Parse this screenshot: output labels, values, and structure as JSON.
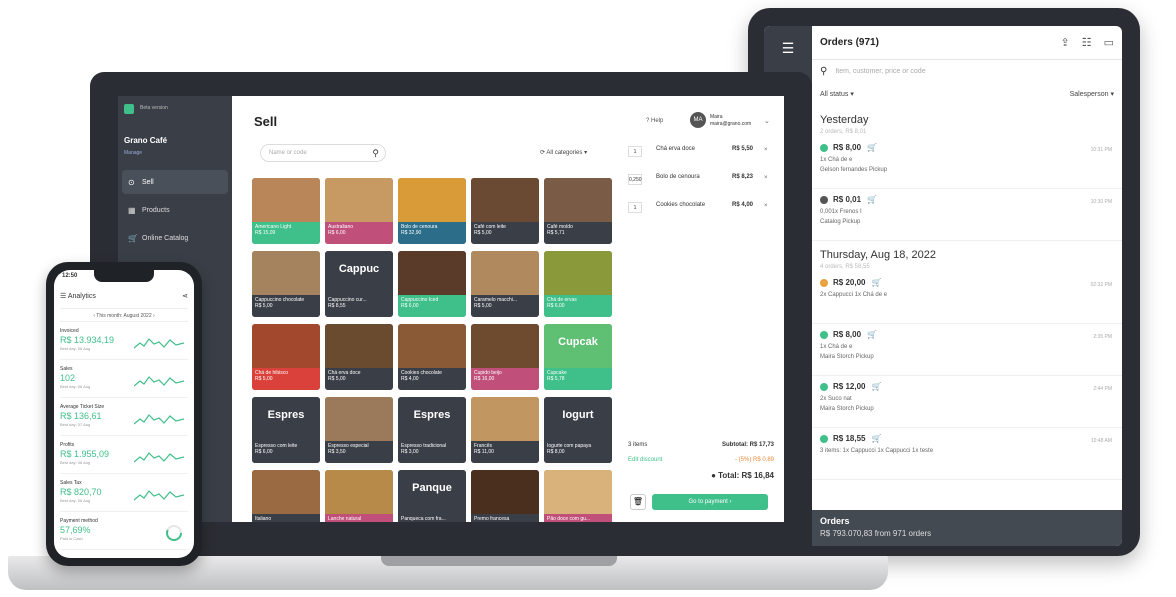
{
  "tablet": {
    "title": "Orders (971)",
    "search_placeholder": "Item, customer, price or code",
    "filter_status": "All status",
    "filter_salesperson": "Salesperson",
    "groups": [
      {
        "title": "Yesterday",
        "sub": "2 orders, R$ 8,01",
        "orders": [
          {
            "amount": "R$ 8,00",
            "line1": "1x Chá de e",
            "line2": "Gelson fernandes  Pickup",
            "time": "10:31 PM",
            "color": "#3fbf8a"
          },
          {
            "amount": "R$ 0,01",
            "line1": "0,001x Frenos I",
            "line2": "Catalog  Pickup",
            "time": "10:30 PM",
            "color": "#555555"
          }
        ]
      },
      {
        "title": "Thursday, Aug 18, 2022",
        "sub": "4 orders, R$ 58,55",
        "orders": [
          {
            "amount": "R$ 20,00",
            "line1": "2x Cappucci 1x Chá de e",
            "line2": "",
            "time": "02:32 PM",
            "color": "#e8a33d"
          },
          {
            "amount": "R$ 8,00",
            "line1": "1x Chá de e",
            "line2": "Maira Storch  Pickup",
            "time": "2:35 PM",
            "color": "#3fbf8a"
          },
          {
            "amount": "R$ 12,00",
            "line1": "2x Suco nat",
            "line2": "Maira Storch  Pickup",
            "time": "2:44 PM",
            "color": "#3fbf8a"
          },
          {
            "amount": "R$ 18,55",
            "line1": "3 items: 1x Cappucci 1x Cappucci 1x teste",
            "line2": "",
            "time": "10:48 AM",
            "color": "#3fbf8a"
          }
        ]
      }
    ],
    "footer_title": "Orders",
    "footer_sub": "R$ 793.070,83 from 971 orders"
  },
  "laptop": {
    "beta": "Beta version",
    "store_name": "Grano Café",
    "store_sub": "Manage",
    "nav": [
      {
        "label": "Sell",
        "icon": "⊙"
      },
      {
        "label": "Products",
        "icon": "▦"
      },
      {
        "label": "Online Catalog",
        "icon": "🛒"
      }
    ],
    "title": "Sell",
    "help": "Help",
    "avatar": "MA",
    "user_name": "Maira",
    "user_email": "maira@grano.com",
    "search_placeholder": "Name or code",
    "categories": "All categories",
    "tiles": [
      {
        "name": "Americano Light",
        "price": "R$ 15,09",
        "color": "#b9865a",
        "cap": "#3fbf8a"
      },
      {
        "name": "Australiano",
        "price": "R$ 6,00",
        "color": "#c79a63",
        "cap": "#c0507a"
      },
      {
        "name": "Bolo de cenoura",
        "price": "R$ 32,90",
        "color": "#d89b38",
        "cap": "#2c6e8a"
      },
      {
        "name": "Café com leite",
        "price": "R$ 5,00",
        "color": "#6b4a33",
        "cap": "#3a3f47"
      },
      {
        "name": "Café moído",
        "price": "R$ 5,71",
        "color": "#7a5b45",
        "cap": "#3a3f47"
      },
      {
        "name": "Cappuccino chocolate",
        "price": "R$ 5,00",
        "color": "#a5835f",
        "cap": "#3a3f47"
      },
      {
        "name": "Cappuccino cur...",
        "price": "R$ 8,55",
        "color": "#3a3f47",
        "cap": "#3a3f47",
        "big": "Cappuc"
      },
      {
        "name": "Cappuccino Iced",
        "price": "R$ 6,00",
        "color": "#5a3b2a",
        "cap": "#3fbf8a"
      },
      {
        "name": "Caramelo macchi...",
        "price": "R$ 5,00",
        "color": "#b08a5e",
        "cap": "#3a3f47"
      },
      {
        "name": "Chá de ervas",
        "price": "R$ 6,00",
        "color": "#8a9a3a",
        "cap": "#3fbf8a"
      },
      {
        "name": "Chá de hibisco",
        "price": "R$ 5,00",
        "color": "#a2492d",
        "cap": "#d9413a"
      },
      {
        "name": "Chá erva doce",
        "price": "R$ 5,00",
        "color": "#6a4b2f",
        "cap": "#3a3f47"
      },
      {
        "name": "Cookies chocolate",
        "price": "R$ 4,00",
        "color": "#8a5a37",
        "cap": "#3a3f47"
      },
      {
        "name": "Cupido beijo",
        "price": "R$ 16,00",
        "color": "#6e4a2e",
        "cap": "#c0507a"
      },
      {
        "name": "Cupcake",
        "price": "R$ 5,78",
        "color": "#5fbf73",
        "cap": "#3fbf8a",
        "big": "Cupcak"
      },
      {
        "name": "Espresso com leite",
        "price": "R$ 6,00",
        "color": "#3a3f47",
        "cap": "#3a3f47",
        "big": "Espres"
      },
      {
        "name": "Espresso especial",
        "price": "R$ 3,50",
        "color": "#9a7a5a",
        "cap": "#3a3f47"
      },
      {
        "name": "Espresso tradicional",
        "price": "R$ 3,00",
        "color": "#3a3f47",
        "cap": "#3a3f47",
        "big": "Espres"
      },
      {
        "name": "Francês",
        "price": "R$ 11,00",
        "color": "#c29660",
        "cap": "#3a3f47"
      },
      {
        "name": "Iogurte com papaya",
        "price": "R$ 8,00",
        "color": "#3a3f47",
        "cap": "#3a3f47",
        "big": "Iogurt"
      },
      {
        "name": "Italiano",
        "price": "",
        "color": "#9a6a42",
        "cap": "#3a3f47"
      },
      {
        "name": "Lanche natural",
        "price": "",
        "color": "#b88a4a",
        "cap": "#c0507a"
      },
      {
        "name": "Panqueca com fra...",
        "price": "",
        "color": "#3a3f47",
        "cap": "#3a3f47",
        "big": "Panque"
      },
      {
        "name": "Premo francesa",
        "price": "",
        "color": "#4a2e1e",
        "cap": "#3a3f47"
      },
      {
        "name": "Pão doce com gu...",
        "price": "",
        "color": "#d8b27a",
        "cap": "#c0507a"
      }
    ],
    "cart": [
      {
        "qty": "1",
        "name": "Chá erva doce",
        "price": "R$ 5,50"
      },
      {
        "qty": "0,250",
        "name": "Bolo de cenoura",
        "price": "R$ 8,23"
      },
      {
        "qty": "1",
        "name": "Cookies chocolate",
        "price": "R$ 4,00"
      }
    ],
    "items_count": "3 items",
    "subtotal": "Subtotal: R$ 17,73",
    "edit_discount": "Edit discount",
    "discount": "- (5%) R$ 0,89",
    "total": "Total: R$ 16,84",
    "pay": "Go to payment"
  },
  "phone": {
    "time": "12:50",
    "title": "Analytics",
    "range": "This month: August 2022",
    "metrics": [
      {
        "label": "Invoiced",
        "value": "R$ 13.934,19",
        "sub": "Best day: 06 Aug"
      },
      {
        "label": "Sales",
        "value": "102",
        "sub": "Best day: 06 Aug"
      },
      {
        "label": "Average Ticket Size",
        "value": "R$ 136,61",
        "sub": "Best day: 07 Aug"
      },
      {
        "label": "Profits",
        "value": "R$ 1.955,09",
        "sub": "Best day: 06 Aug"
      },
      {
        "label": "Sales Tax",
        "value": "R$ 820,70",
        "sub": "Best day: 06 Aug"
      },
      {
        "label": "Payment method",
        "value": "57,69%",
        "sub": "Paid in Cash"
      }
    ]
  }
}
